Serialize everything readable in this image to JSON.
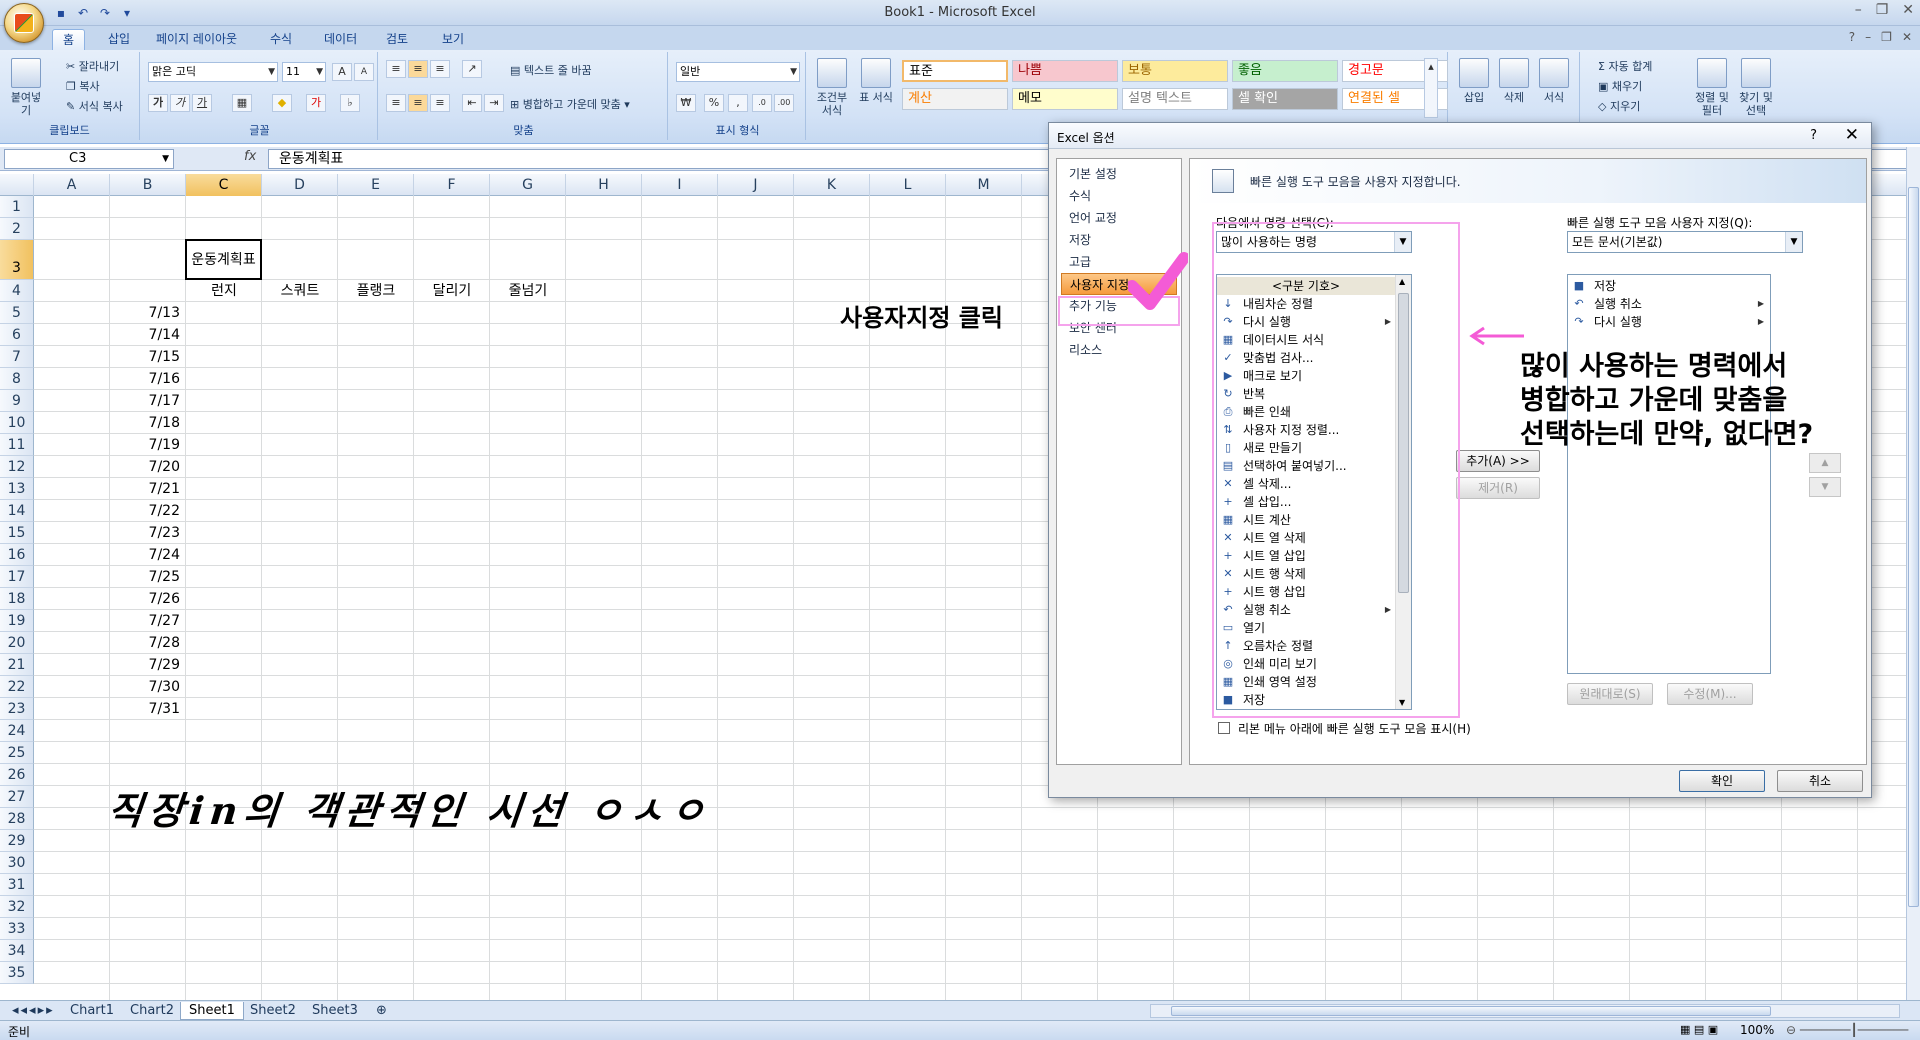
{
  "window": {
    "title": "Book1 - Microsoft Excel"
  },
  "tabs": [
    "홈",
    "삽입",
    "페이지 레이아웃",
    "수식",
    "데이터",
    "검토",
    "보기"
  ],
  "ribbon": {
    "clipboard": {
      "label": "클립보드",
      "paste": "붙여넣기",
      "cut": "잘라내기",
      "copy": "복사",
      "format_painter": "서식 복사"
    },
    "font": {
      "label": "글꼴",
      "name": "맑은 고딕",
      "size": "11"
    },
    "alignment": {
      "label": "맞춤",
      "wrap": "텍스트 줄 바꿈",
      "merge": "병합하고 가운데 맞춤"
    },
    "number": {
      "label": "표시 형식",
      "format": "일반"
    },
    "styles": {
      "conditional": "조건부 서식",
      "table": "표 서식",
      "cells": [
        {
          "text": "표준",
          "bg": "#ffffff",
          "color": "#000000"
        },
        {
          "text": "나쁨",
          "bg": "#f7c7ce",
          "color": "#9c0006"
        },
        {
          "text": "보통",
          "bg": "#fdeb9c",
          "color": "#9c6500"
        },
        {
          "text": "좋음",
          "bg": "#c6efce",
          "color": "#006100"
        },
        {
          "text": "경고문",
          "bg": "#ffffff",
          "color": "#ff0000"
        },
        {
          "text": "계산",
          "bg": "#f2f2f2",
          "color": "#fa7d00"
        },
        {
          "text": "메모",
          "bg": "#fffdcc",
          "color": "#000000"
        },
        {
          "text": "설명 텍스트",
          "bg": "#ffffff",
          "color": "#7f7f7f"
        },
        {
          "text": "셀 확인",
          "bg": "#a5a5a5",
          "color": "#ffffff"
        },
        {
          "text": "연결된 셀",
          "bg": "#ffffff",
          "color": "#fa7d00"
        }
      ]
    },
    "cells_group": {
      "insert": "삽입",
      "delete": "삭제",
      "format": "서식"
    },
    "editing": {
      "autosum": "자동 합계",
      "fill": "채우기",
      "clear": "지우기",
      "sort": "정렬 및 필터",
      "find": "찾기 및 선택"
    }
  },
  "formula_bar": {
    "name_box": "C3",
    "fx": "fx",
    "content": "운동계획표"
  },
  "sheet": {
    "columns": [
      "A",
      "B",
      "C",
      "D",
      "E",
      "F",
      "G",
      "H",
      "I",
      "J",
      "K",
      "L",
      "M"
    ],
    "rows": [
      "1",
      "2",
      "3",
      "4",
      "5",
      "6",
      "7",
      "8",
      "9",
      "10",
      "11",
      "12",
      "13",
      "14",
      "15",
      "16",
      "17",
      "18",
      "19",
      "20",
      "21",
      "22",
      "23",
      "24",
      "25",
      "26",
      "27",
      "28",
      "29",
      "30",
      "31",
      "32",
      "33",
      "34",
      "35"
    ],
    "c3": "운동계획표",
    "headers": [
      "런지",
      "스쿼트",
      "플랭크",
      "달리기",
      "줄넘기"
    ],
    "dates": [
      "7/13",
      "7/14",
      "7/15",
      "7/16",
      "7/17",
      "7/18",
      "7/19",
      "7/20",
      "7/21",
      "7/22",
      "7/23",
      "7/24",
      "7/25",
      "7/26",
      "7/27",
      "7/28",
      "7/29",
      "7/30",
      "7/31"
    ]
  },
  "sheet_tabs": [
    "Chart1",
    "Chart2",
    "Sheet1",
    "Sheet2",
    "Sheet3"
  ],
  "status": {
    "ready": "준비",
    "zoom": "100%"
  },
  "dialog": {
    "title": "Excel 옵션",
    "help": "?",
    "nav": [
      "기본 설정",
      "수식",
      "언어 교정",
      "저장",
      "고급",
      "사용자 지정",
      "추가 기능",
      "보안 센터",
      "리소스"
    ],
    "banner": "빠른 실행 도구 모음을 사용자 지정합니다.",
    "choose_label": "다음에서 명령 선택(C):",
    "choose_value": "많이 사용하는 명령",
    "customize_label": "빠른 실행 도구 모음 사용자 지정(Q):",
    "customize_value": "모든 문서(기본값)",
    "commands": [
      {
        "label": "<구분 기호>",
        "icon": "",
        "sub": false
      },
      {
        "label": "내림차순 정렬",
        "icon": "↓",
        "sub": false
      },
      {
        "label": "다시 실행",
        "icon": "↷",
        "sub": true
      },
      {
        "label": "데이터시트 서식",
        "icon": "▦",
        "sub": false
      },
      {
        "label": "맞춤법 검사...",
        "icon": "✓",
        "sub": false
      },
      {
        "label": "매크로 보기",
        "icon": "▶",
        "sub": false
      },
      {
        "label": "반복",
        "icon": "↻",
        "sub": false
      },
      {
        "label": "빠른 인쇄",
        "icon": "⎙",
        "sub": false
      },
      {
        "label": "사용자 지정 정렬...",
        "icon": "⇅",
        "sub": false
      },
      {
        "label": "새로 만들기",
        "icon": "▯",
        "sub": false
      },
      {
        "label": "선택하여 붙여넣기...",
        "icon": "▤",
        "sub": false
      },
      {
        "label": "셀 삭제...",
        "icon": "✕",
        "sub": false
      },
      {
        "label": "셀 삽입...",
        "icon": "+",
        "sub": false
      },
      {
        "label": "시트 계산",
        "icon": "▦",
        "sub": false
      },
      {
        "label": "시트 열 삭제",
        "icon": "✕",
        "sub": false
      },
      {
        "label": "시트 열 삽입",
        "icon": "+",
        "sub": false
      },
      {
        "label": "시트 행 삭제",
        "icon": "✕",
        "sub": false
      },
      {
        "label": "시트 행 삽입",
        "icon": "+",
        "sub": false
      },
      {
        "label": "실행 취소",
        "icon": "↶",
        "sub": true
      },
      {
        "label": "열기",
        "icon": "▭",
        "sub": false
      },
      {
        "label": "오름차순 정렬",
        "icon": "↑",
        "sub": false
      },
      {
        "label": "인쇄 미리 보기",
        "icon": "◎",
        "sub": false
      },
      {
        "label": "인쇄 영역 설정",
        "icon": "▦",
        "sub": false
      },
      {
        "label": "저장",
        "icon": "■",
        "sub": false
      }
    ],
    "qat_items": [
      {
        "label": "저장",
        "icon": "■",
        "sub": false
      },
      {
        "label": "실행 취소",
        "icon": "↶",
        "sub": true
      },
      {
        "label": "다시 실행",
        "icon": "↷",
        "sub": true
      }
    ],
    "add": "추가(A) >>",
    "remove": "제거(R)",
    "reset": "원래대로(S)",
    "modify": "수정(M)...",
    "show_below": "리본 메뉴 아래에 빠른 실행 도구 모음 표시(H)",
    "ok": "확인",
    "cancel": "취소"
  },
  "annotations": {
    "click": "사용자지정 클릭",
    "note_lines": [
      "많이 사용하는 명력에서",
      "병합하고 가운데 맞춤을",
      "선택하는데 만약, 없다면?"
    ],
    "watermark": "직장in의 객관적인 시선 ㅇㅅㅇ"
  }
}
